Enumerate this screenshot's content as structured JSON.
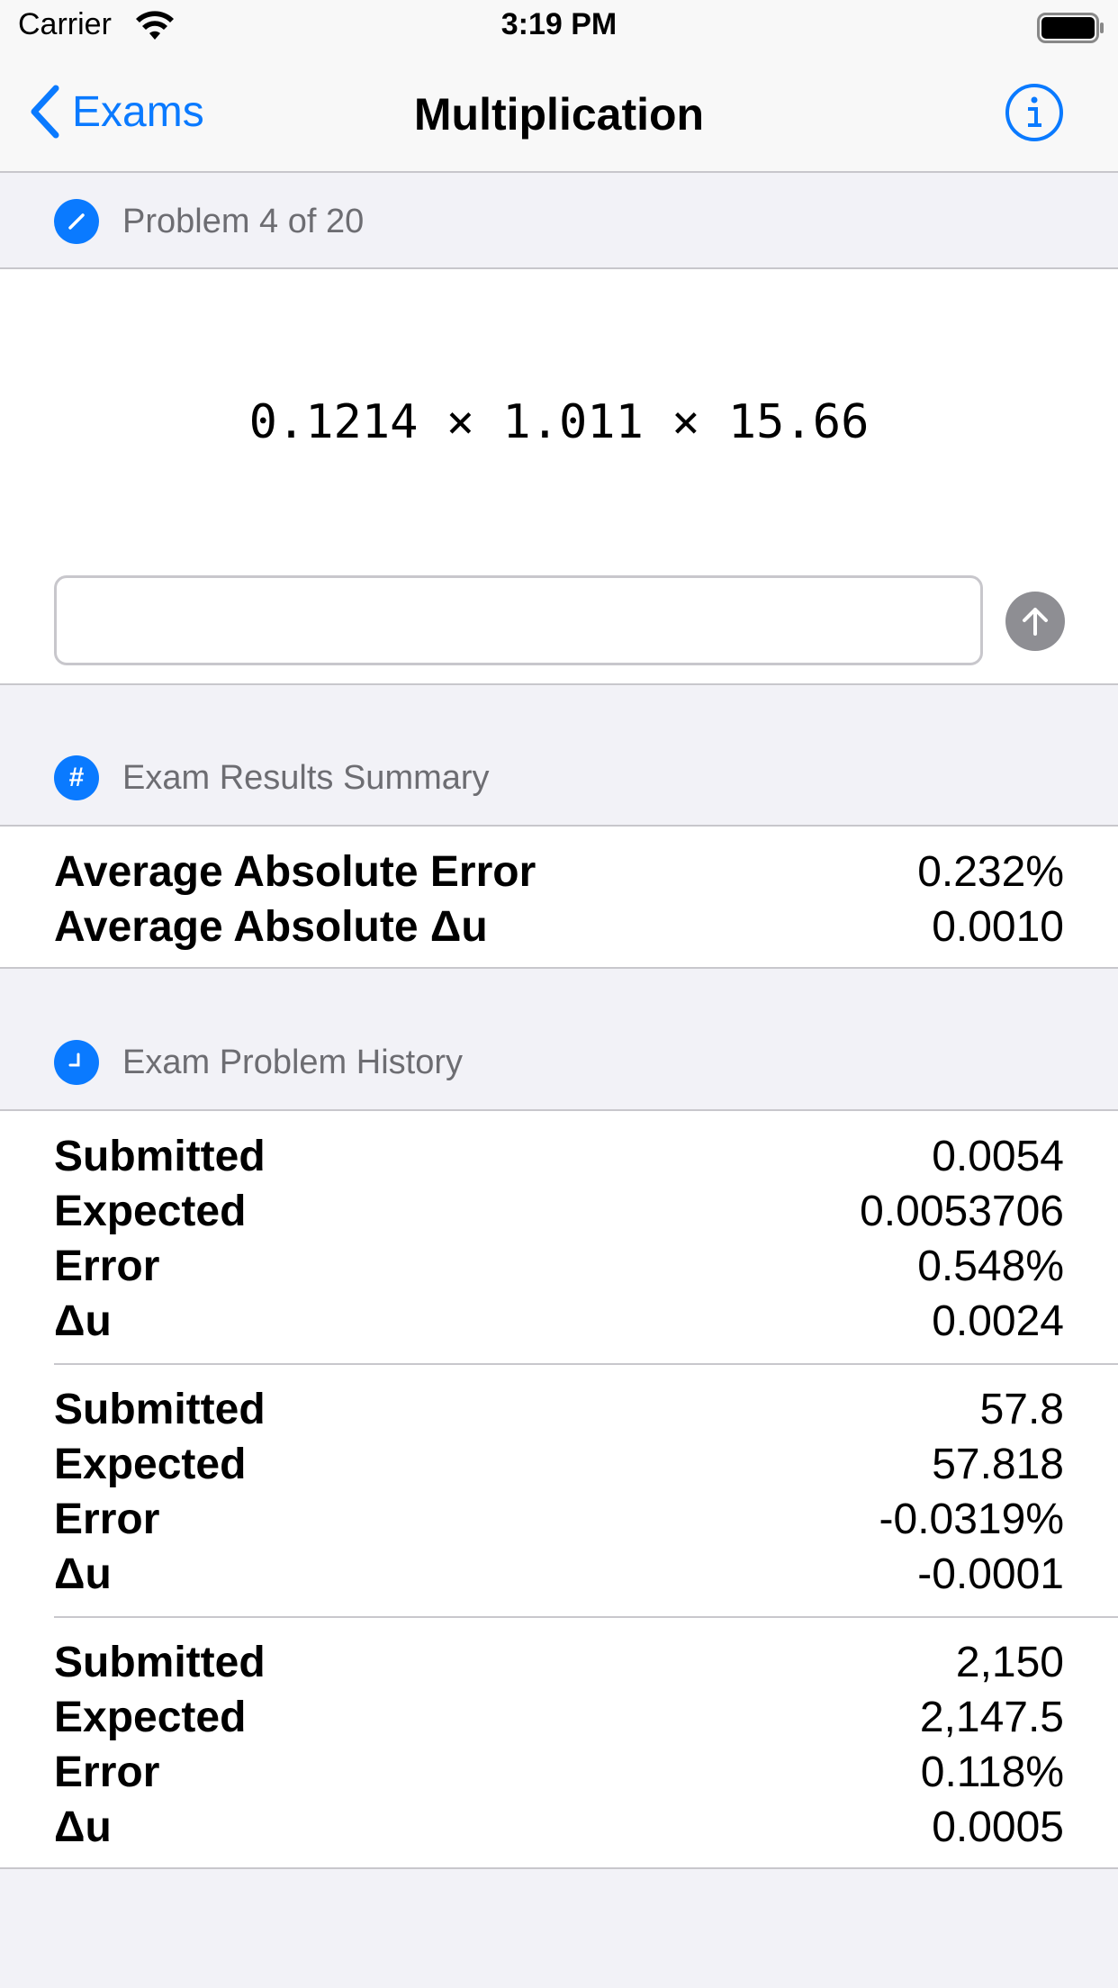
{
  "status_bar": {
    "carrier": "Carrier",
    "time": "3:19 PM",
    "wifi_icon": "wifi-icon",
    "battery_icon": "battery-icon"
  },
  "nav": {
    "back_label": "Exams",
    "title": "Multiplication",
    "info_icon": "info-circle-icon"
  },
  "problem": {
    "header": "Problem 4 of 20",
    "header_icon": "pencil-icon",
    "expression": "0.1214 × 1.011 × 15.66",
    "answer_value": "",
    "answer_placeholder": "",
    "submit_icon": "arrow-up-icon"
  },
  "summary": {
    "header": "Exam Results Summary",
    "header_icon": "number-sign-icon",
    "rows": [
      {
        "label": "Average Absolute Error",
        "value": "0.232%"
      },
      {
        "label": "Average Absolute Δu",
        "value": "0.0010"
      }
    ]
  },
  "history": {
    "header": "Exam Problem History",
    "header_icon": "clock-icon",
    "items": [
      {
        "submitted_label": "Submitted",
        "submitted": "0.0054",
        "expected_label": "Expected",
        "expected": "0.0053706",
        "error_label": "Error",
        "error": "0.548%",
        "delta_label": "Δu",
        "delta": "0.0024"
      },
      {
        "submitted_label": "Submitted",
        "submitted": "57.8",
        "expected_label": "Expected",
        "expected": "57.818",
        "error_label": "Error",
        "error": "-0.0319%",
        "delta_label": "Δu",
        "delta": "-0.0001"
      },
      {
        "submitted_label": "Submitted",
        "submitted": "2,150",
        "expected_label": "Expected",
        "expected": "2,147.5",
        "error_label": "Error",
        "error": "0.118%",
        "delta_label": "Δu",
        "delta": "0.0005"
      }
    ]
  },
  "colors": {
    "accent": "#0a7aff",
    "background": "#f2f2f7",
    "secondary_text": "#6d6d72",
    "disabled_button": "#8e8e93"
  }
}
